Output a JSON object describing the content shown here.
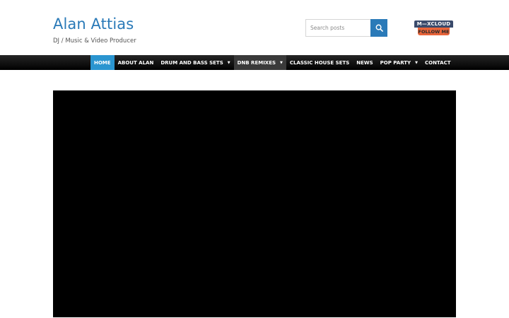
{
  "site": {
    "title": "Alan Attias",
    "tagline": "DJ / Music & Video Producer"
  },
  "search": {
    "placeholder": "Search posts",
    "icon": "search-icon"
  },
  "badge": {
    "top_text": "M—XCLOUD",
    "bottom_text": "FOLLOW ME",
    "colors": {
      "top": "#3a4a6b",
      "bottom": "#e8643a"
    }
  },
  "nav": {
    "items": [
      {
        "label": "HOME",
        "active": true,
        "dropdown": false
      },
      {
        "label": "ABOUT ALAN",
        "active": false,
        "dropdown": false
      },
      {
        "label": "DRUM AND BASS SETS",
        "active": false,
        "dropdown": true
      },
      {
        "label": "DNB REMIXES",
        "active": false,
        "dropdown": true
      },
      {
        "label": "CLASSIC HOUSE SETS",
        "active": false,
        "dropdown": false
      },
      {
        "label": "NEWS",
        "active": false,
        "dropdown": false
      },
      {
        "label": "POP PARTY",
        "active": false,
        "dropdown": true
      },
      {
        "label": "CONTACT",
        "active": false,
        "dropdown": false
      }
    ],
    "dropdown_caret": "▼"
  },
  "colors": {
    "accent": "#2a7ab8",
    "nav_active": "#2a95d0",
    "nav_bg": "#000000",
    "video_bg": "#000000"
  }
}
